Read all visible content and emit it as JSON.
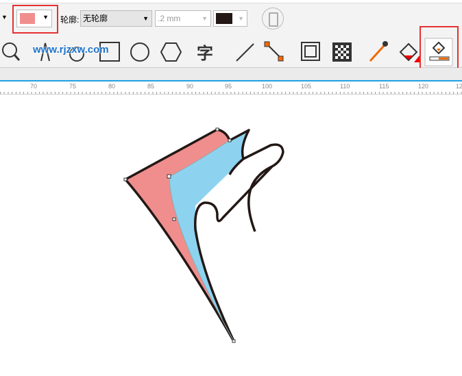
{
  "property_bar": {
    "fill_color": "#F08E8E",
    "outline_label": "轮廓:",
    "outline_style": "无轮廓",
    "outline_width": ".2 mm",
    "outline_color": "#231815"
  },
  "watermark": "www.rjzxw.com",
  "toolbox": {
    "icons": [
      "zoom-icon",
      "freehand-icon",
      "artistic-media-icon",
      "rectangle-icon",
      "ellipse-icon",
      "polygon-icon",
      "text-icon",
      "dimension-icon",
      "connector-icon",
      "contour-icon",
      "transparency-icon",
      "eyedropper-icon",
      "interactive-fill-icon",
      "smart-fill-icon"
    ],
    "active": "smart-fill-icon"
  },
  "ruler": {
    "labels": [
      "70",
      "75",
      "80",
      "85",
      "90",
      "95",
      "100",
      "105",
      "110",
      "115",
      "120",
      "12"
    ]
  },
  "colors": {
    "pink": "#F08E8E",
    "blue": "#8DD3F0",
    "outline": "#231815",
    "highlight": "#E63030"
  }
}
